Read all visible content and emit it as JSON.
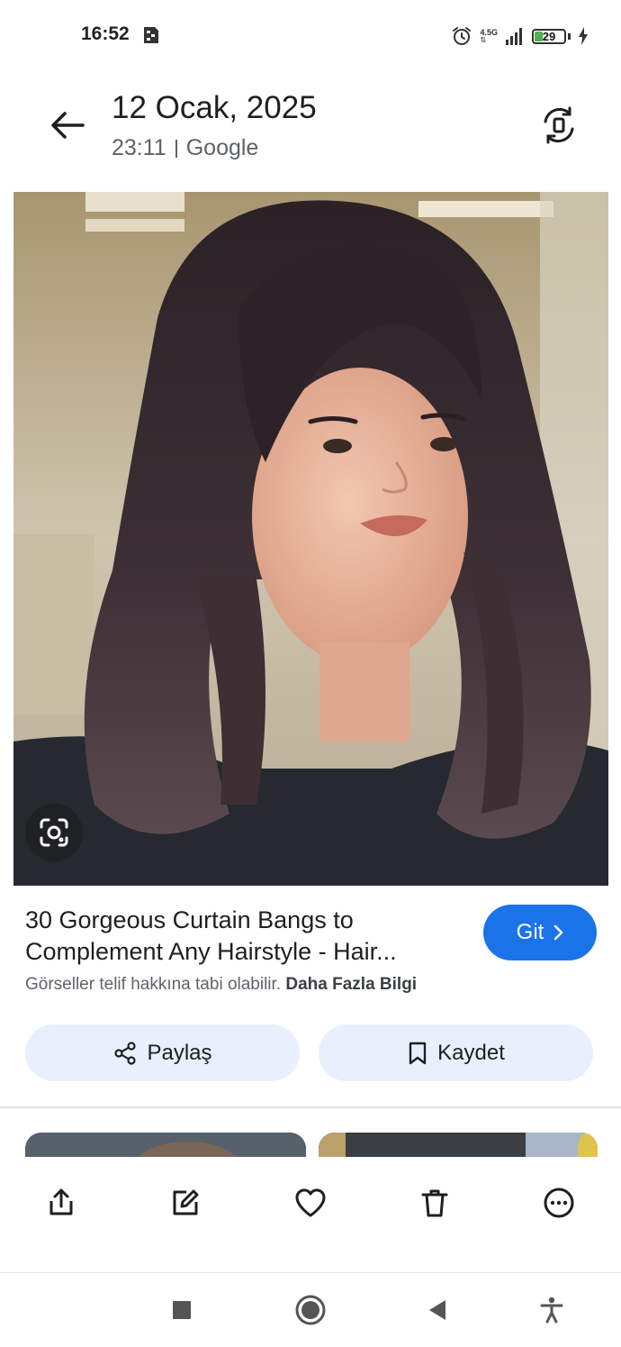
{
  "status_bar": {
    "time": "16:52",
    "network_label": "4.5G",
    "battery_level": "29",
    "battery_fraction": 0.29,
    "icons": [
      "sim-card-icon",
      "alarm-icon",
      "signal-icon",
      "battery-icon",
      "charging-icon"
    ]
  },
  "header": {
    "date": "12 Ocak, 2025",
    "time": "23:11",
    "source": "Google",
    "back_icon": "arrow-left-icon",
    "rotate_icon": "screen-rotate-icon"
  },
  "result": {
    "title_line1": "30 Gorgeous Curtain Bangs to",
    "title_line2": "Complement Any Hairstyle - Hair...",
    "go_button": "Git",
    "notice": "Görseller telif hakkına tabi olabilir.",
    "more_info": "Daha Fazla Bilgi"
  },
  "actions": {
    "share_label": "Paylaş",
    "save_label": "Kaydet"
  },
  "bottom_bar": {
    "icons": [
      "share-icon",
      "edit-icon",
      "favorite-icon",
      "delete-icon",
      "more-icon"
    ]
  },
  "nav_bar": {
    "icons": [
      "recents-square-icon",
      "home-circle-icon",
      "back-triangle-icon",
      "accessibility-icon"
    ]
  },
  "colors": {
    "accent_blue": "#1a73e8",
    "pill_background": "#e8f0fe",
    "battery_green": "#4caf50"
  }
}
